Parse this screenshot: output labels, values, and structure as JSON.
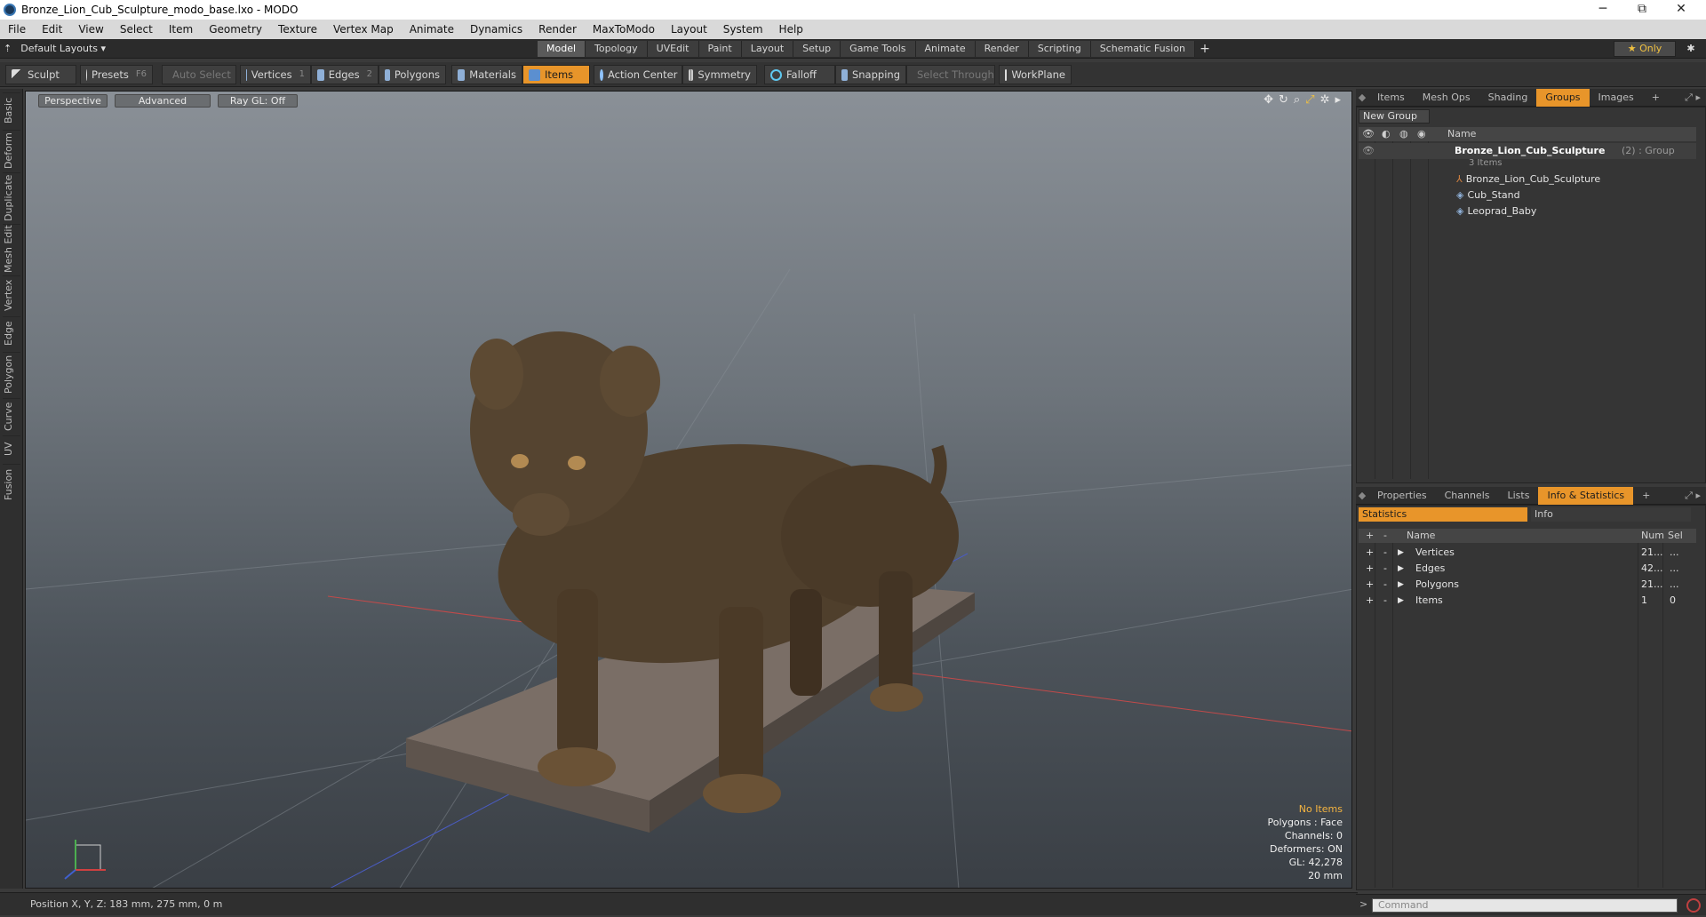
{
  "window": {
    "title": "Bronze_Lion_Cub_Sculpture_modo_base.lxo - MODO",
    "minimize": "─",
    "maximize": "⧉",
    "close": "✕"
  },
  "menu": [
    "File",
    "Edit",
    "View",
    "Select",
    "Item",
    "Geometry",
    "Texture",
    "Vertex Map",
    "Animate",
    "Dynamics",
    "Render",
    "MaxToModo",
    "Layout",
    "System",
    "Help"
  ],
  "layout": {
    "default_layouts": "Default Layouts ▾",
    "tabs": [
      "Model",
      "Topology",
      "UVEdit",
      "Paint",
      "Layout",
      "Setup",
      "Game Tools",
      "Animate",
      "Render",
      "Scripting",
      "Schematic Fusion"
    ],
    "active_tab": "Model",
    "plus": "+",
    "only": "★  Only"
  },
  "toolbar": {
    "sculpt": "Sculpt",
    "presets": "Presets",
    "presets_key": "F6",
    "auto_select": "Auto Select",
    "vertices": "Vertices",
    "vertices_key": "1",
    "edges": "Edges",
    "edges_key": "2",
    "polygons": "Polygons",
    "materials": "Materials",
    "items": "Items",
    "action_center": "Action Center",
    "symmetry": "Symmetry",
    "falloff": "Falloff",
    "snapping": "Snapping",
    "select_through": "Select Through",
    "workplane": "WorkPlane"
  },
  "side_tabs": [
    "Basic",
    "Deform",
    "Duplicate",
    "Mesh Edit",
    "Vertex",
    "Edge",
    "Polygon",
    "Curve",
    "UV",
    "Fusion"
  ],
  "viewport": {
    "perspective": "Perspective",
    "advanced": "Advanced",
    "raygl": "Ray GL: Off",
    "info": {
      "no_items": "No Items",
      "polygons": "Polygons : Face",
      "channels": "Channels: 0",
      "deformers": "Deformers: ON",
      "gl": "GL: 42,278",
      "scale": "20 mm"
    }
  },
  "status": {
    "position": "Position X, Y, Z:   183 mm, 275 mm, 0 m"
  },
  "top_panel": {
    "tabs": [
      "Items",
      "Mesh Ops",
      "Shading",
      "Groups",
      "Images"
    ],
    "active": "Groups",
    "new_group": "New Group",
    "col_name": "Name",
    "group_name": "Bronze_Lion_Cub_Sculpture",
    "group_suffix": "(2) : Group",
    "group_count": "3 Items",
    "children": [
      "Bronze_Lion_Cub_Sculpture",
      "Cub_Stand",
      "Leoprad_Baby"
    ]
  },
  "bottom_panel": {
    "tabs": [
      "Properties",
      "Channels",
      "Lists",
      "Info & Statistics"
    ],
    "active": "Info & Statistics",
    "sub_tabs": [
      "Statistics",
      "Info"
    ],
    "cols": {
      "name": "Name",
      "num": "Num",
      "sel": "Sel"
    },
    "rows": [
      {
        "name": "Vertices",
        "num": "21...",
        "sel": "..."
      },
      {
        "name": "Edges",
        "num": "42...",
        "sel": "..."
      },
      {
        "name": "Polygons",
        "num": "21...",
        "sel": "..."
      },
      {
        "name": "Items",
        "num": "1",
        "sel": "0"
      }
    ]
  },
  "command": {
    "placeholder": "Command"
  },
  "colors": {
    "accent": "#e8952a",
    "highlight_text": "#f4b440"
  }
}
